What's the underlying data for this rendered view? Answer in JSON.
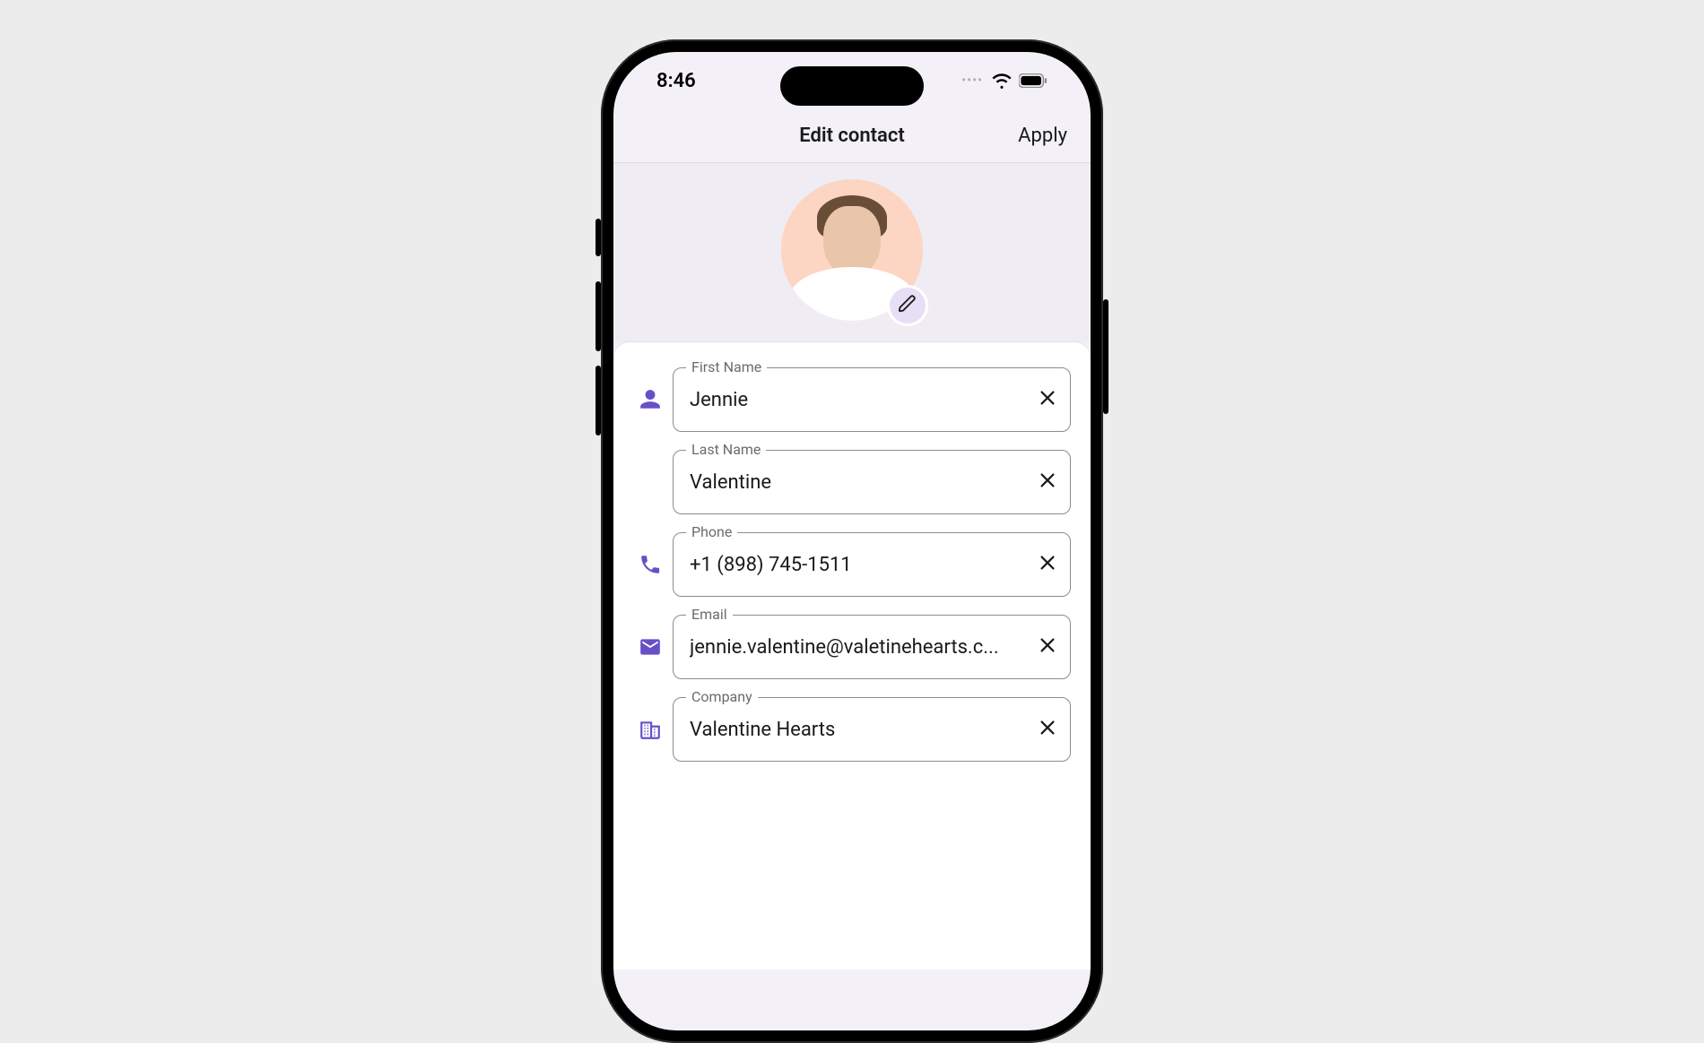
{
  "status": {
    "time": "8:46"
  },
  "nav": {
    "title": "Edit contact",
    "apply": "Apply"
  },
  "fields": {
    "first_name": {
      "label": "First Name",
      "value": "Jennie"
    },
    "last_name": {
      "label": "Last Name",
      "value": "Valentine"
    },
    "phone": {
      "label": "Phone",
      "value": "+1 (898) 745-1511"
    },
    "email": {
      "label": "Email",
      "value": "jennie.valentine@valetinehearts.c..."
    },
    "company": {
      "label": "Company",
      "value": "Valentine Hearts"
    }
  }
}
